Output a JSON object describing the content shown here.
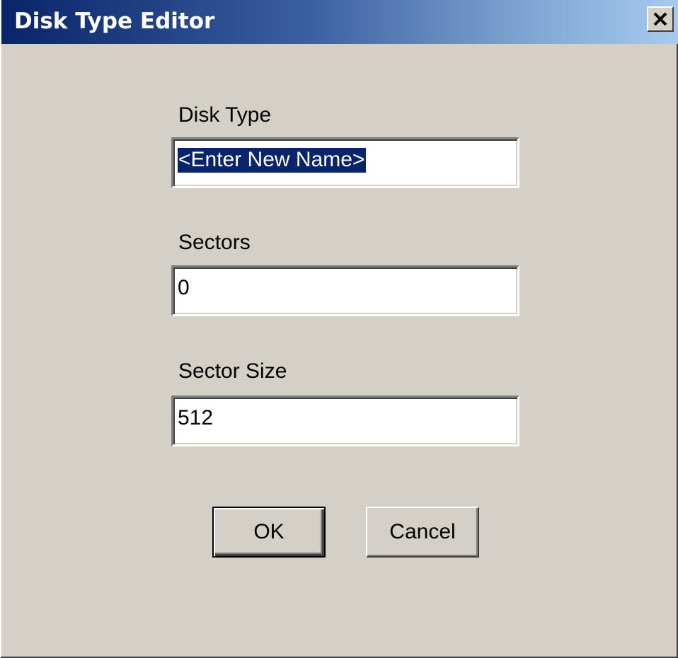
{
  "window": {
    "title": "Disk Type Editor"
  },
  "icons": {
    "close": "close-icon"
  },
  "fields": {
    "disk_type": {
      "label": "Disk Type",
      "value": "<Enter New Name>",
      "selected": true
    },
    "sectors": {
      "label": "Sectors",
      "value": "0"
    },
    "sector_size": {
      "label": "Sector Size",
      "value": "512"
    }
  },
  "buttons": {
    "ok_label": "OK",
    "cancel_label": "Cancel"
  },
  "colors": {
    "title_start": "#0a246a",
    "title_end": "#a6caf0",
    "dialog_bg": "#d4d0c8",
    "selection_bg": "#0a246a"
  }
}
